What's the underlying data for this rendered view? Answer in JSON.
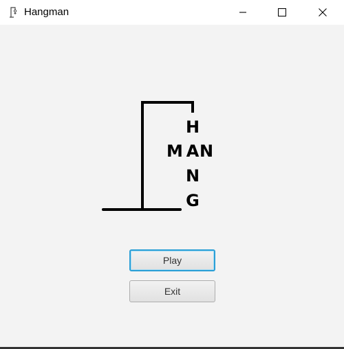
{
  "window": {
    "title": "Hangman",
    "icon": "app-icon",
    "controls": [
      "minimize-icon",
      "maximize-icon",
      "close-icon"
    ]
  },
  "logo": {
    "letters_vertical": [
      "H",
      "A",
      "N",
      "G"
    ],
    "letters_horizontal": [
      "M",
      "A",
      "N"
    ]
  },
  "menu": {
    "play_label": "Play",
    "exit_label": "Exit"
  },
  "colors": {
    "background": "#f3f3f3",
    "focus_ring": "#2a9fd6",
    "gallows": "#000000"
  }
}
